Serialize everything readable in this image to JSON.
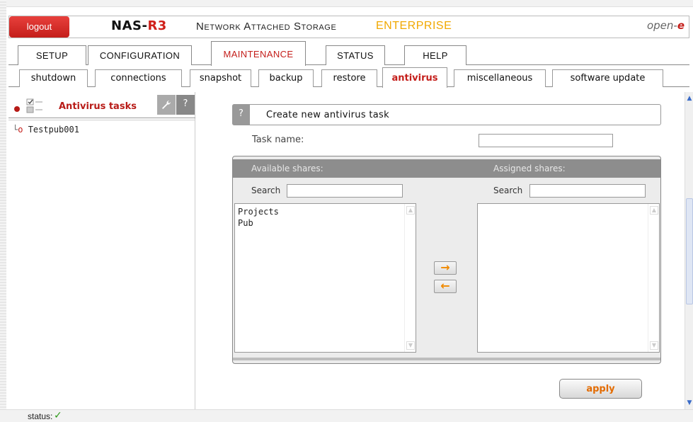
{
  "header": {
    "logout_label": "logout",
    "brand_prefix": "NAS-",
    "brand_suffix": "R3",
    "product": "Network Attached Storage",
    "edition": "ENTERPRISE",
    "vendor_prefix": "open-",
    "vendor_suffix": "e"
  },
  "main_tabs": [
    {
      "label": "SETUP",
      "active": false
    },
    {
      "label": "CONFIGURATION",
      "active": false
    },
    {
      "label": "MAINTENANCE",
      "active": true
    },
    {
      "label": "STATUS",
      "active": false
    },
    {
      "label": "HELP",
      "active": false
    }
  ],
  "sub_tabs": [
    {
      "label": "shutdown",
      "active": false
    },
    {
      "label": "connections",
      "active": false
    },
    {
      "label": "snapshot",
      "active": false
    },
    {
      "label": "backup",
      "active": false
    },
    {
      "label": "restore",
      "active": false
    },
    {
      "label": "antivirus",
      "active": true
    },
    {
      "label": "miscellaneous",
      "active": false
    },
    {
      "label": "software update",
      "active": false
    }
  ],
  "left_panel": {
    "title": "Antivirus tasks",
    "help_label": "?",
    "tree": [
      {
        "label": "Testpub001"
      }
    ]
  },
  "form": {
    "help_label": "?",
    "title": "Create new antivirus task",
    "task_name_label": "Task name:",
    "task_name_value": "",
    "available_label": "Available shares:",
    "assigned_label": "Assigned shares:",
    "search_label": "Search",
    "available_search_value": "",
    "assigned_search_value": "",
    "available_shares": [
      "Projects",
      "Pub"
    ],
    "assigned_shares": [],
    "add_arrow": "→",
    "remove_arrow": "←",
    "apply_label": "apply"
  },
  "status": {
    "label": "status:",
    "icon": "check-icon",
    "color": "#2f9a1a"
  },
  "colors": {
    "accent_red": "#c41e1a",
    "edition_yellow": "#f1a800",
    "apply_orange": "#e36b00"
  }
}
